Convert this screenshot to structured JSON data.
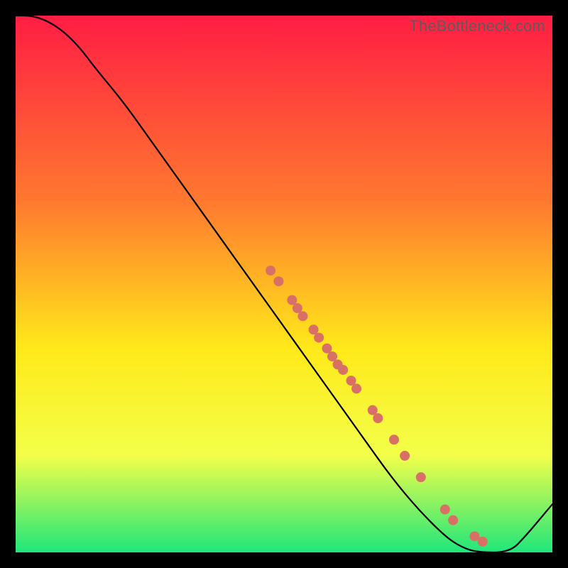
{
  "watermark": "TheBottleneck.com",
  "colors": {
    "gradient_top": "#ff1d44",
    "gradient_mid1": "#ff7a2f",
    "gradient_mid2": "#ffe91a",
    "gradient_mid3": "#f3ff4a",
    "gradient_bottom": "#1fe67a",
    "frame": "#000000",
    "curve": "#000000",
    "dot_fill": "#d87066",
    "dot_stroke": "#b44f48"
  },
  "chart_data": {
    "type": "line",
    "title": "",
    "xlabel": "",
    "ylabel": "",
    "xlim": [
      0,
      100
    ],
    "ylim": [
      0,
      100
    ],
    "curve": [
      {
        "x": 0,
        "y": 100
      },
      {
        "x": 3,
        "y": 100
      },
      {
        "x": 6,
        "y": 99
      },
      {
        "x": 9,
        "y": 97
      },
      {
        "x": 12,
        "y": 94
      },
      {
        "x": 15,
        "y": 90
      },
      {
        "x": 20,
        "y": 84
      },
      {
        "x": 25,
        "y": 77
      },
      {
        "x": 30,
        "y": 70
      },
      {
        "x": 35,
        "y": 63
      },
      {
        "x": 40,
        "y": 56
      },
      {
        "x": 45,
        "y": 49
      },
      {
        "x": 50,
        "y": 42
      },
      {
        "x": 55,
        "y": 35
      },
      {
        "x": 60,
        "y": 28
      },
      {
        "x": 65,
        "y": 21
      },
      {
        "x": 70,
        "y": 14
      },
      {
        "x": 75,
        "y": 8
      },
      {
        "x": 80,
        "y": 3
      },
      {
        "x": 83,
        "y": 1
      },
      {
        "x": 86,
        "y": 0
      },
      {
        "x": 92,
        "y": 0
      },
      {
        "x": 95,
        "y": 3
      },
      {
        "x": 100,
        "y": 9
      }
    ],
    "series": [
      {
        "name": "markers",
        "points": [
          {
            "x": 47.5,
            "y": 52.5
          },
          {
            "x": 49.0,
            "y": 50.5
          },
          {
            "x": 51.5,
            "y": 47.0
          },
          {
            "x": 52.5,
            "y": 45.5
          },
          {
            "x": 53.5,
            "y": 44.0
          },
          {
            "x": 55.5,
            "y": 41.5
          },
          {
            "x": 56.5,
            "y": 40.0
          },
          {
            "x": 58.0,
            "y": 38.0
          },
          {
            "x": 59.0,
            "y": 36.5
          },
          {
            "x": 60.0,
            "y": 35.0
          },
          {
            "x": 61.0,
            "y": 34.0
          },
          {
            "x": 62.5,
            "y": 32.0
          },
          {
            "x": 63.5,
            "y": 30.5
          },
          {
            "x": 66.5,
            "y": 26.5
          },
          {
            "x": 67.5,
            "y": 25.0
          },
          {
            "x": 70.5,
            "y": 21.0
          },
          {
            "x": 72.5,
            "y": 18.0
          },
          {
            "x": 75.5,
            "y": 14.0
          },
          {
            "x": 80.0,
            "y": 8.0
          },
          {
            "x": 81.5,
            "y": 6.0
          },
          {
            "x": 85.5,
            "y": 3.0
          },
          {
            "x": 87.0,
            "y": 2.0
          }
        ]
      }
    ]
  }
}
